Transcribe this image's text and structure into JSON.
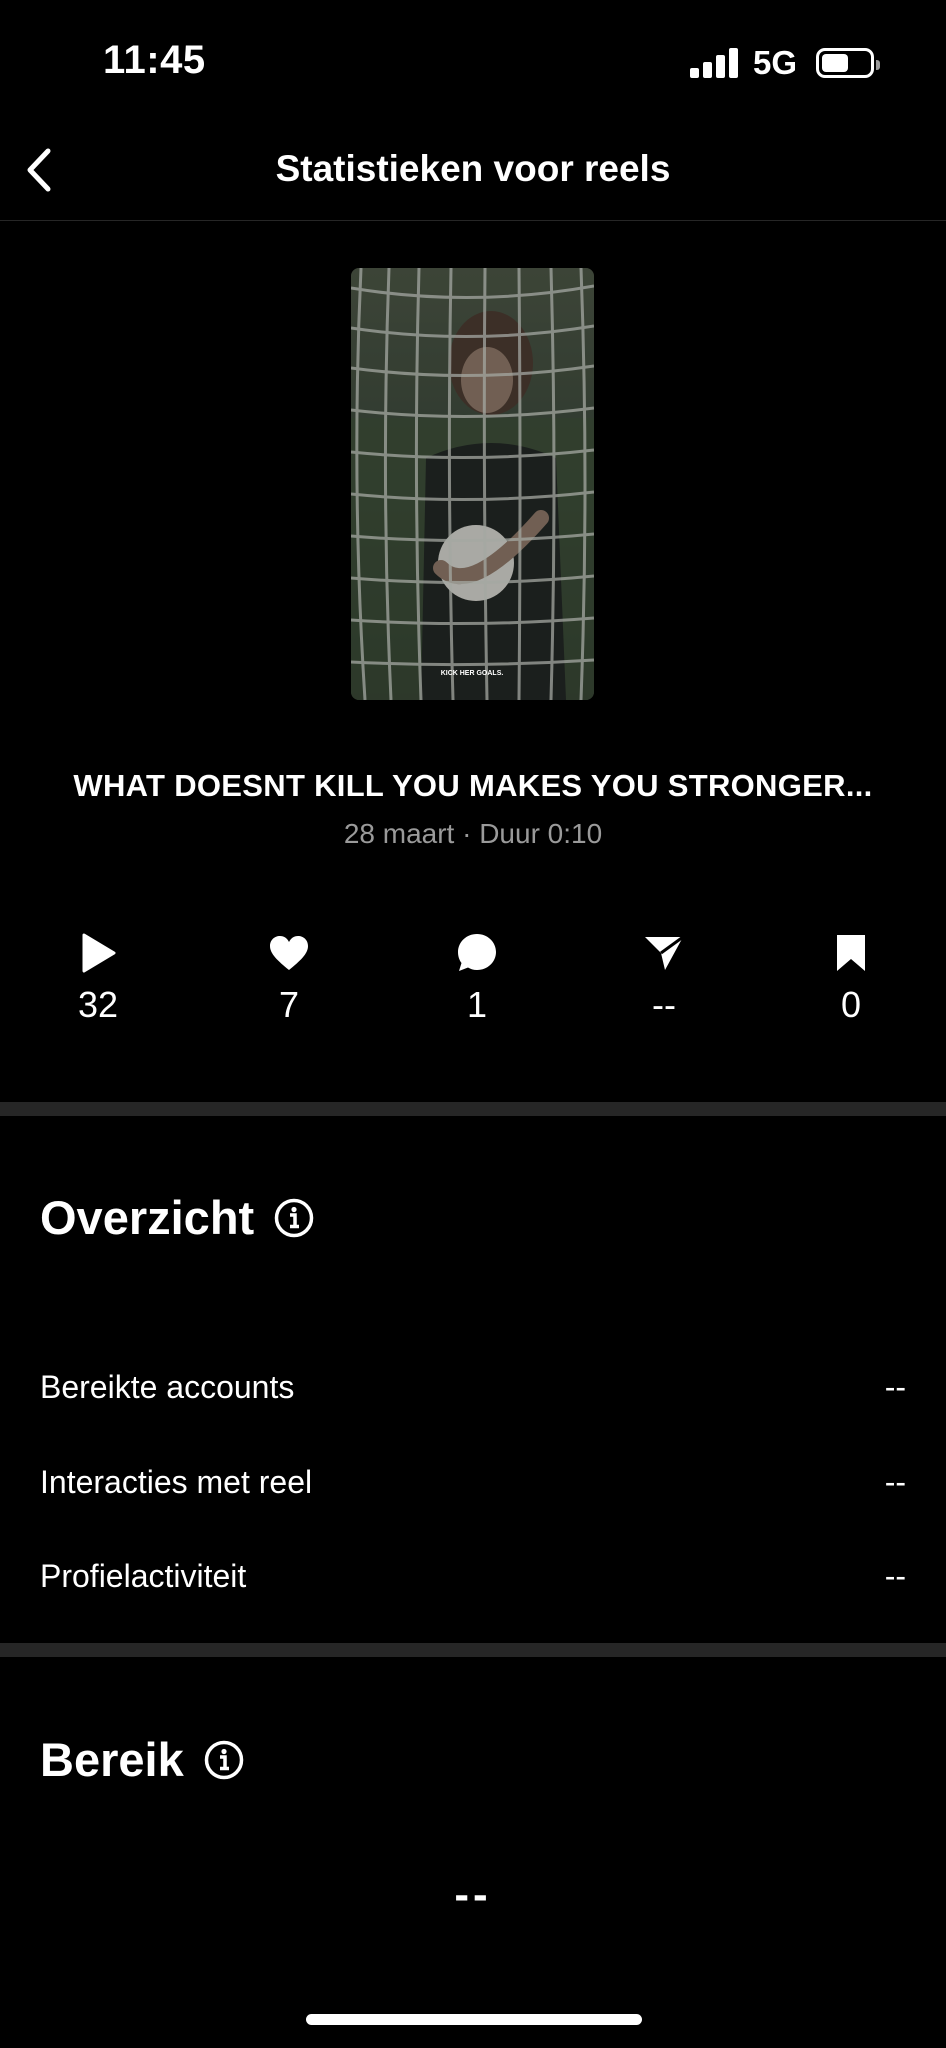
{
  "status_bar": {
    "time": "11:45",
    "network": "5G"
  },
  "header": {
    "title": "Statistieken voor reels",
    "back_icon": "chevron-left-icon"
  },
  "reel": {
    "thumbnail_caption": "KICK HER GOALS.",
    "title": "WHAT DOESNT KILL YOU MAKES YOU STRONGER...",
    "subtitle": "28 maart · Duur 0:10"
  },
  "metrics": [
    {
      "icon": "play-icon",
      "value": "32"
    },
    {
      "icon": "heart-icon",
      "value": "7"
    },
    {
      "icon": "comment-icon",
      "value": "1"
    },
    {
      "icon": "send-icon",
      "value": "--"
    },
    {
      "icon": "bookmark-icon",
      "value": "0"
    }
  ],
  "overview": {
    "title": "Overzicht",
    "rows": [
      {
        "label": "Bereikte accounts",
        "value": "--"
      },
      {
        "label": "Interacties met reel",
        "value": "--"
      },
      {
        "label": "Profielactiviteit",
        "value": "--"
      }
    ]
  },
  "reach": {
    "title": "Bereik",
    "value": "--"
  },
  "colors": {
    "background": "#000000",
    "divider": "#262626",
    "secondary_text": "#9a9a9a"
  }
}
